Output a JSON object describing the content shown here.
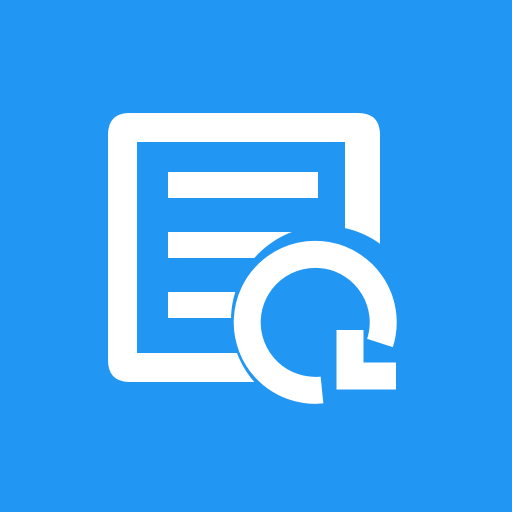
{
  "app_icon": {
    "icon_name": "document-refresh-icon",
    "background_color": "#2196F3",
    "foreground_color": "#FFFFFF",
    "components": [
      "document-frame-icon",
      "document-lines-icon",
      "refresh-arrow-icon"
    ]
  }
}
